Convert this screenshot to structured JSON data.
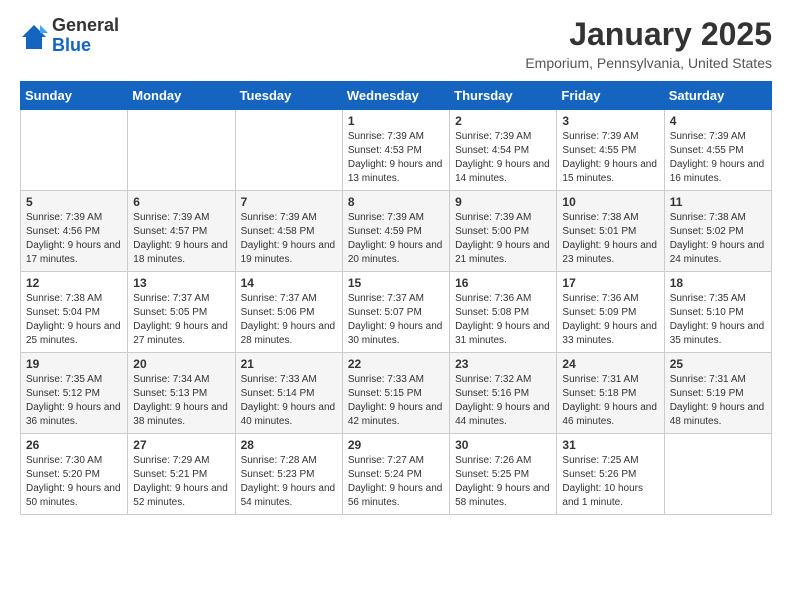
{
  "header": {
    "logo": {
      "general": "General",
      "blue": "Blue"
    },
    "title": "January 2025",
    "location": "Emporium, Pennsylvania, United States"
  },
  "calendar": {
    "weekdays": [
      "Sunday",
      "Monday",
      "Tuesday",
      "Wednesday",
      "Thursday",
      "Friday",
      "Saturday"
    ],
    "weeks": [
      [
        {
          "day": null,
          "sunrise": null,
          "sunset": null,
          "daylight": null
        },
        {
          "day": null,
          "sunrise": null,
          "sunset": null,
          "daylight": null
        },
        {
          "day": null,
          "sunrise": null,
          "sunset": null,
          "daylight": null
        },
        {
          "day": "1",
          "sunrise": "Sunrise: 7:39 AM",
          "sunset": "Sunset: 4:53 PM",
          "daylight": "Daylight: 9 hours and 13 minutes."
        },
        {
          "day": "2",
          "sunrise": "Sunrise: 7:39 AM",
          "sunset": "Sunset: 4:54 PM",
          "daylight": "Daylight: 9 hours and 14 minutes."
        },
        {
          "day": "3",
          "sunrise": "Sunrise: 7:39 AM",
          "sunset": "Sunset: 4:55 PM",
          "daylight": "Daylight: 9 hours and 15 minutes."
        },
        {
          "day": "4",
          "sunrise": "Sunrise: 7:39 AM",
          "sunset": "Sunset: 4:55 PM",
          "daylight": "Daylight: 9 hours and 16 minutes."
        }
      ],
      [
        {
          "day": "5",
          "sunrise": "Sunrise: 7:39 AM",
          "sunset": "Sunset: 4:56 PM",
          "daylight": "Daylight: 9 hours and 17 minutes."
        },
        {
          "day": "6",
          "sunrise": "Sunrise: 7:39 AM",
          "sunset": "Sunset: 4:57 PM",
          "daylight": "Daylight: 9 hours and 18 minutes."
        },
        {
          "day": "7",
          "sunrise": "Sunrise: 7:39 AM",
          "sunset": "Sunset: 4:58 PM",
          "daylight": "Daylight: 9 hours and 19 minutes."
        },
        {
          "day": "8",
          "sunrise": "Sunrise: 7:39 AM",
          "sunset": "Sunset: 4:59 PM",
          "daylight": "Daylight: 9 hours and 20 minutes."
        },
        {
          "day": "9",
          "sunrise": "Sunrise: 7:39 AM",
          "sunset": "Sunset: 5:00 PM",
          "daylight": "Daylight: 9 hours and 21 minutes."
        },
        {
          "day": "10",
          "sunrise": "Sunrise: 7:38 AM",
          "sunset": "Sunset: 5:01 PM",
          "daylight": "Daylight: 9 hours and 23 minutes."
        },
        {
          "day": "11",
          "sunrise": "Sunrise: 7:38 AM",
          "sunset": "Sunset: 5:02 PM",
          "daylight": "Daylight: 9 hours and 24 minutes."
        }
      ],
      [
        {
          "day": "12",
          "sunrise": "Sunrise: 7:38 AM",
          "sunset": "Sunset: 5:04 PM",
          "daylight": "Daylight: 9 hours and 25 minutes."
        },
        {
          "day": "13",
          "sunrise": "Sunrise: 7:37 AM",
          "sunset": "Sunset: 5:05 PM",
          "daylight": "Daylight: 9 hours and 27 minutes."
        },
        {
          "day": "14",
          "sunrise": "Sunrise: 7:37 AM",
          "sunset": "Sunset: 5:06 PM",
          "daylight": "Daylight: 9 hours and 28 minutes."
        },
        {
          "day": "15",
          "sunrise": "Sunrise: 7:37 AM",
          "sunset": "Sunset: 5:07 PM",
          "daylight": "Daylight: 9 hours and 30 minutes."
        },
        {
          "day": "16",
          "sunrise": "Sunrise: 7:36 AM",
          "sunset": "Sunset: 5:08 PM",
          "daylight": "Daylight: 9 hours and 31 minutes."
        },
        {
          "day": "17",
          "sunrise": "Sunrise: 7:36 AM",
          "sunset": "Sunset: 5:09 PM",
          "daylight": "Daylight: 9 hours and 33 minutes."
        },
        {
          "day": "18",
          "sunrise": "Sunrise: 7:35 AM",
          "sunset": "Sunset: 5:10 PM",
          "daylight": "Daylight: 9 hours and 35 minutes."
        }
      ],
      [
        {
          "day": "19",
          "sunrise": "Sunrise: 7:35 AM",
          "sunset": "Sunset: 5:12 PM",
          "daylight": "Daylight: 9 hours and 36 minutes."
        },
        {
          "day": "20",
          "sunrise": "Sunrise: 7:34 AM",
          "sunset": "Sunset: 5:13 PM",
          "daylight": "Daylight: 9 hours and 38 minutes."
        },
        {
          "day": "21",
          "sunrise": "Sunrise: 7:33 AM",
          "sunset": "Sunset: 5:14 PM",
          "daylight": "Daylight: 9 hours and 40 minutes."
        },
        {
          "day": "22",
          "sunrise": "Sunrise: 7:33 AM",
          "sunset": "Sunset: 5:15 PM",
          "daylight": "Daylight: 9 hours and 42 minutes."
        },
        {
          "day": "23",
          "sunrise": "Sunrise: 7:32 AM",
          "sunset": "Sunset: 5:16 PM",
          "daylight": "Daylight: 9 hours and 44 minutes."
        },
        {
          "day": "24",
          "sunrise": "Sunrise: 7:31 AM",
          "sunset": "Sunset: 5:18 PM",
          "daylight": "Daylight: 9 hours and 46 minutes."
        },
        {
          "day": "25",
          "sunrise": "Sunrise: 7:31 AM",
          "sunset": "Sunset: 5:19 PM",
          "daylight": "Daylight: 9 hours and 48 minutes."
        }
      ],
      [
        {
          "day": "26",
          "sunrise": "Sunrise: 7:30 AM",
          "sunset": "Sunset: 5:20 PM",
          "daylight": "Daylight: 9 hours and 50 minutes."
        },
        {
          "day": "27",
          "sunrise": "Sunrise: 7:29 AM",
          "sunset": "Sunset: 5:21 PM",
          "daylight": "Daylight: 9 hours and 52 minutes."
        },
        {
          "day": "28",
          "sunrise": "Sunrise: 7:28 AM",
          "sunset": "Sunset: 5:23 PM",
          "daylight": "Daylight: 9 hours and 54 minutes."
        },
        {
          "day": "29",
          "sunrise": "Sunrise: 7:27 AM",
          "sunset": "Sunset: 5:24 PM",
          "daylight": "Daylight: 9 hours and 56 minutes."
        },
        {
          "day": "30",
          "sunrise": "Sunrise: 7:26 AM",
          "sunset": "Sunset: 5:25 PM",
          "daylight": "Daylight: 9 hours and 58 minutes."
        },
        {
          "day": "31",
          "sunrise": "Sunrise: 7:25 AM",
          "sunset": "Sunset: 5:26 PM",
          "daylight": "Daylight: 10 hours and 1 minute."
        },
        {
          "day": null,
          "sunrise": null,
          "sunset": null,
          "daylight": null
        }
      ]
    ]
  }
}
